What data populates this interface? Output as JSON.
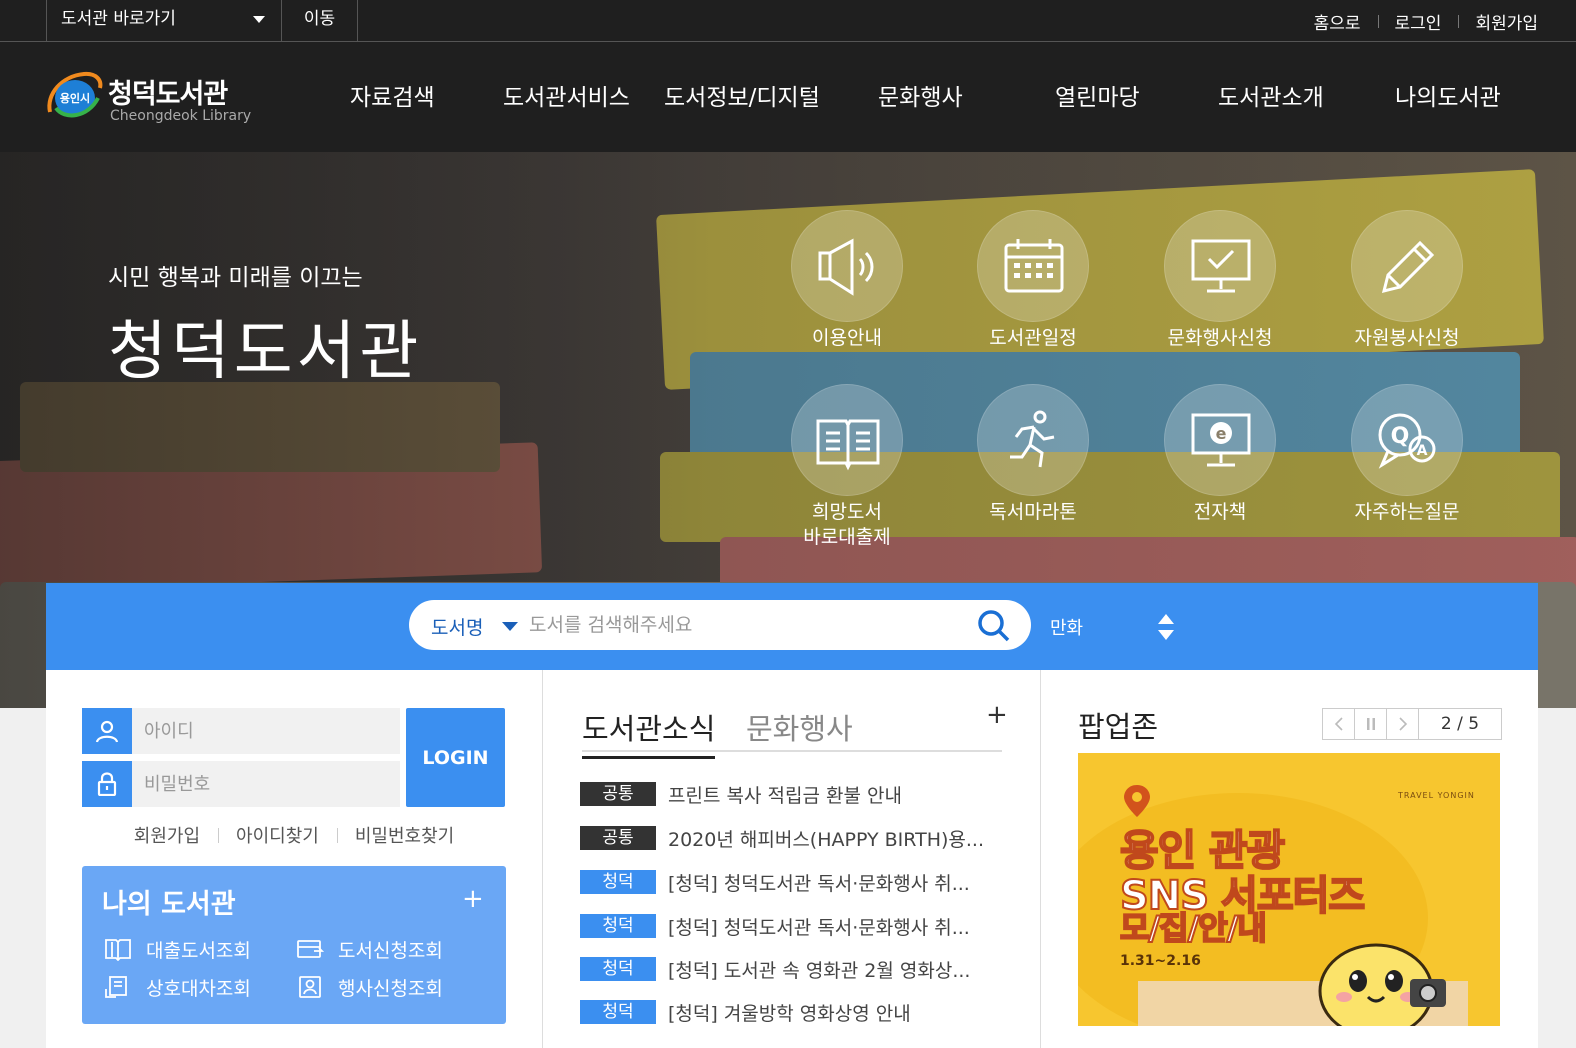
{
  "topbar": {
    "library_select": "도서관 바로가기",
    "go_button": "이동",
    "utils": [
      "홈으로",
      "로그인",
      "회원가입"
    ]
  },
  "logo": {
    "badge": "용인시",
    "title": "청덕도서관",
    "subtitle": "Cheongdeok Library"
  },
  "nav": [
    "자료검색",
    "도서관서비스",
    "도서정보/디지털",
    "문화행사",
    "열린마당",
    "도서관소개",
    "나의도서관"
  ],
  "hero": {
    "subtitle": "시민 행복과 미래를 이끄는",
    "title": "청덕도서관"
  },
  "quick_links": [
    {
      "label": "이용안내",
      "icon": "megaphone-icon"
    },
    {
      "label": "도서관일정",
      "icon": "calendar-icon"
    },
    {
      "label": "문화행사신청",
      "icon": "monitor-check-icon"
    },
    {
      "label": "자원봉사신청",
      "icon": "pencil-icon"
    },
    {
      "label": "희망도서\n바로대출제",
      "icon": "open-book-icon"
    },
    {
      "label": "독서마라톤",
      "icon": "runner-icon"
    },
    {
      "label": "전자책",
      "icon": "ebook-monitor-icon"
    },
    {
      "label": "자주하는질문",
      "icon": "qa-bubble-icon"
    }
  ],
  "search": {
    "type": "도서명",
    "placeholder": "도서를 검색해주세요",
    "keyword": "만화"
  },
  "login": {
    "id_placeholder": "아이디",
    "pw_placeholder": "비밀번호",
    "button": "LOGIN",
    "links": [
      "회원가입",
      "아이디찾기",
      "비밀번호찾기"
    ]
  },
  "mylibrary": {
    "title": "나의 도서관",
    "more": "+",
    "items": [
      "대출도서조회",
      "도서신청조회",
      "상호대차조회",
      "행사신청조회"
    ]
  },
  "news": {
    "tabs": [
      "도서관소식",
      "문화행사"
    ],
    "more": "+",
    "items": [
      {
        "badge": "공통",
        "text": "프린트 복사 적립금 환불 안내",
        "color": "#333333"
      },
      {
        "badge": "공통",
        "text": "2020년 해피버스(HAPPY BIRTH)용...",
        "color": "#333333"
      },
      {
        "badge": "청덕",
        "text": "[청덕] 청덕도서관 독서·문화행사 취...",
        "color": "#3b8ff0"
      },
      {
        "badge": "청덕",
        "text": "[청덕] 청덕도서관 독서·문화행사 취...",
        "color": "#3b8ff0"
      },
      {
        "badge": "청덕",
        "text": "[청덕] 도서관 속 영화관 2월 영화상...",
        "color": "#3b8ff0"
      },
      {
        "badge": "청덕",
        "text": "[청덕] 겨울방학 영화상영 안내",
        "color": "#3b8ff0"
      }
    ]
  },
  "popup": {
    "title": "팝업존",
    "counter": "2 / 5",
    "banner": {
      "small": "TRAVEL YONGIN",
      "line1": "용인 관광",
      "line2": "SNS 서포터즈",
      "line3": "모/집/안/내",
      "date": "1.31~2.16"
    }
  },
  "colors": {
    "accent": "#3b8ff0",
    "header_bg": "#1f1f1f",
    "mylib_bg": "#6aa7f5",
    "banner_bg": "#f7c62f"
  }
}
